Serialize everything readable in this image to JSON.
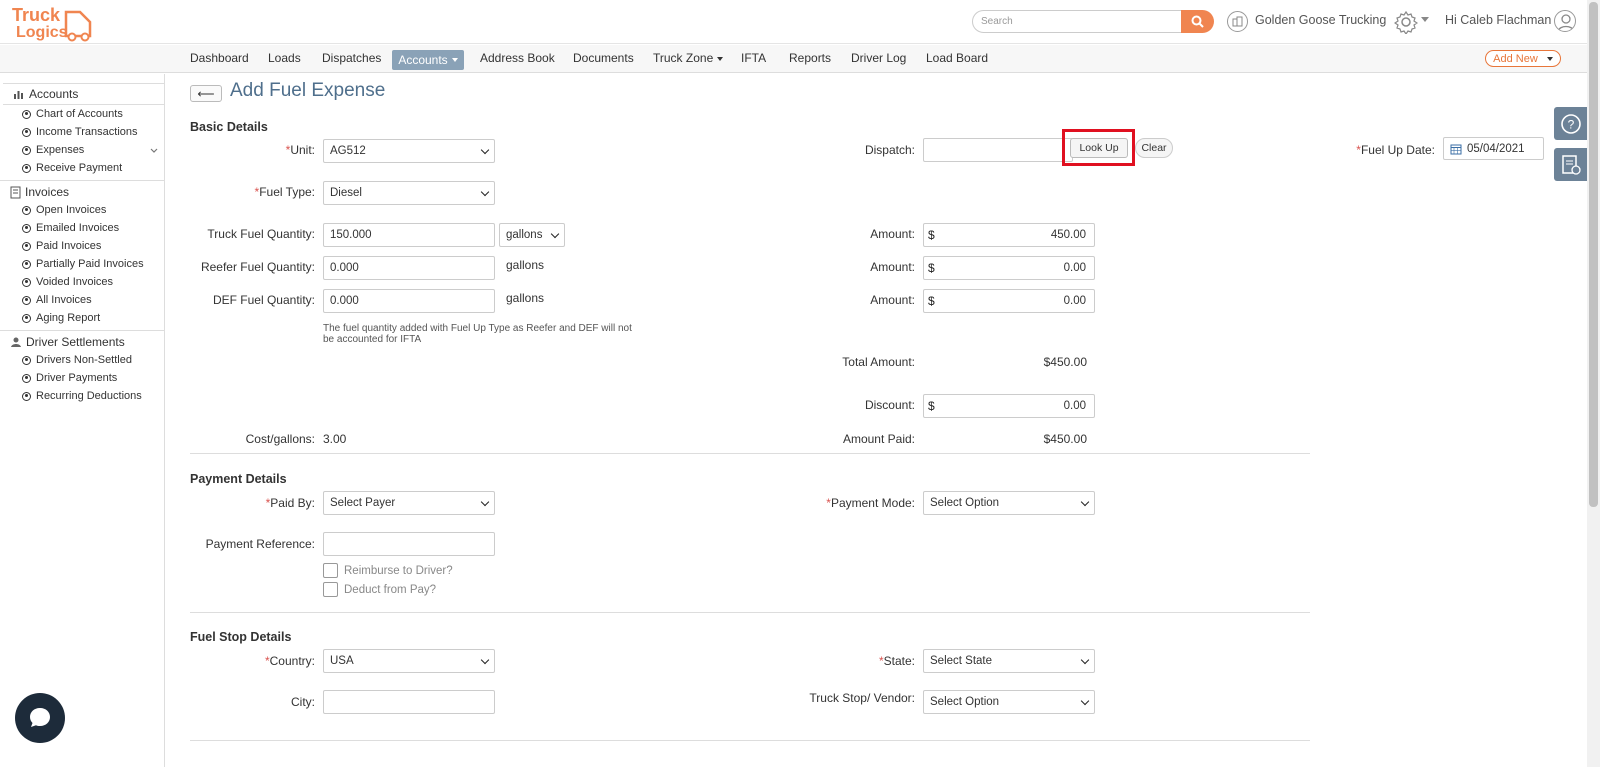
{
  "brand": {
    "logo_text_1": "Truck",
    "logo_text_2": "Logics",
    "accent": "#f08550"
  },
  "header": {
    "search_placeholder": "Search",
    "company": "Golden Goose Trucking",
    "greeting": "Hi Caleb Flachman"
  },
  "nav": {
    "items": [
      "Dashboard",
      "Loads",
      "Dispatches",
      "Accounts",
      "Address Book",
      "Documents",
      "Truck Zone",
      "IFTA",
      "Reports",
      "Driver Log",
      "Load Board"
    ],
    "active": "Accounts",
    "add_new": "Add New"
  },
  "sidebar": {
    "accounts": {
      "title": "Accounts",
      "items": [
        "Chart of Accounts",
        "Income Transactions",
        "Expenses",
        "Receive Payment"
      ]
    },
    "invoices": {
      "title": "Invoices",
      "items": [
        "Open Invoices",
        "Emailed Invoices",
        "Paid Invoices",
        "Partially Paid Invoices",
        "Voided Invoices",
        "All Invoices",
        "Aging Report"
      ]
    },
    "settlements": {
      "title": "Driver Settlements",
      "items": [
        "Drivers Non-Settled",
        "Driver Payments",
        "Recurring Deductions"
      ]
    }
  },
  "page": {
    "title": "Add Fuel Expense",
    "back": "⟵"
  },
  "basic": {
    "section": "Basic Details",
    "unit_label": "Unit:",
    "unit_value": "AG512",
    "fuel_type_label": "Fuel Type:",
    "fuel_type_value": "Diesel",
    "truck_qty_label": "Truck Fuel Quantity:",
    "truck_qty_value": "150.000",
    "truck_unit_select": "gallons",
    "reefer_qty_label": "Reefer Fuel Quantity:",
    "reefer_qty_value": "0.000",
    "reefer_unit": "gallons",
    "def_qty_label": "DEF Fuel Quantity:",
    "def_qty_value": "0.000",
    "def_unit": "gallons",
    "note": "The fuel quantity added with Fuel Up Type as Reefer and DEF will not be accounted for IFTA",
    "cost_label": "Cost/gallons:",
    "cost_value": "3.00",
    "dispatch_label": "Dispatch:",
    "dispatch_value": "",
    "lookup": "Look Up",
    "clear": "Clear",
    "fuel_date_label": "Fuel Up Date:",
    "fuel_date_value": "05/04/2021",
    "amount_label": "Amount:",
    "currency": "$",
    "truck_amount": "450.00",
    "reefer_amount": "0.00",
    "def_amount": "0.00",
    "total_label": "Total Amount:",
    "total_value": "$450.00",
    "discount_label": "Discount:",
    "discount_value": "0.00",
    "paid_label": "Amount Paid:",
    "paid_value": "$450.00"
  },
  "payment": {
    "section": "Payment Details",
    "paid_by_label": "Paid By:",
    "paid_by_value": "Select Payer",
    "mode_label": "Payment Mode:",
    "mode_value": "Select Option",
    "ref_label": "Payment Reference:",
    "ref_value": "",
    "reimburse": "Reimburse to Driver?",
    "deduct": "Deduct from Pay?"
  },
  "fuelstop": {
    "section": "Fuel Stop Details",
    "country_label": "Country:",
    "country_value": "USA",
    "state_label": "State:",
    "state_value": "Select State",
    "city_label": "City:",
    "city_value": "",
    "vendor_label": "Truck Stop/ Vendor:",
    "vendor_value": "Select Option"
  },
  "required_mark": "*"
}
